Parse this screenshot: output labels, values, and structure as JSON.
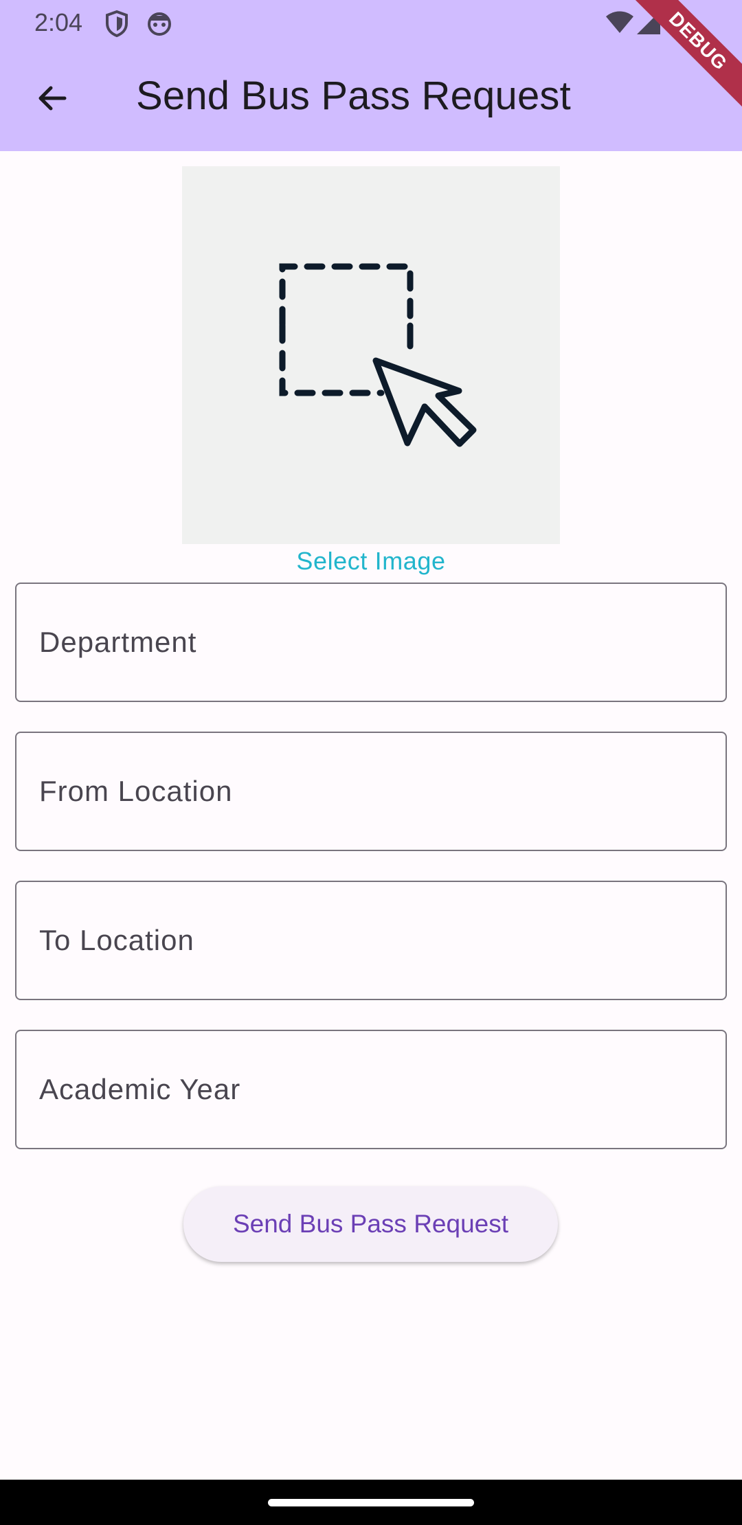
{
  "status_bar": {
    "time": "2:04",
    "icons": [
      "shield-icon",
      "android-icon",
      "wifi-icon",
      "signal-icon",
      "battery-icon"
    ]
  },
  "app_bar": {
    "title": "Send Bus Pass Request",
    "back_icon": "arrow-back-icon",
    "color": "#d0bcff"
  },
  "debug_banner": "DEBUG",
  "image_picker": {
    "icon": "select-area-cursor-icon",
    "label": "Select Image"
  },
  "form": {
    "fields": [
      {
        "name": "department",
        "placeholder": "Department",
        "value": ""
      },
      {
        "name": "from_location",
        "placeholder": "From Location",
        "value": ""
      },
      {
        "name": "to_location",
        "placeholder": "To Location",
        "value": ""
      },
      {
        "name": "academic_year",
        "placeholder": "Academic Year",
        "value": ""
      }
    ],
    "submit_label": "Send Bus Pass Request"
  },
  "colors": {
    "accent": "#6b3fb5",
    "link": "#22b5cc",
    "field_border": "#79747e"
  }
}
